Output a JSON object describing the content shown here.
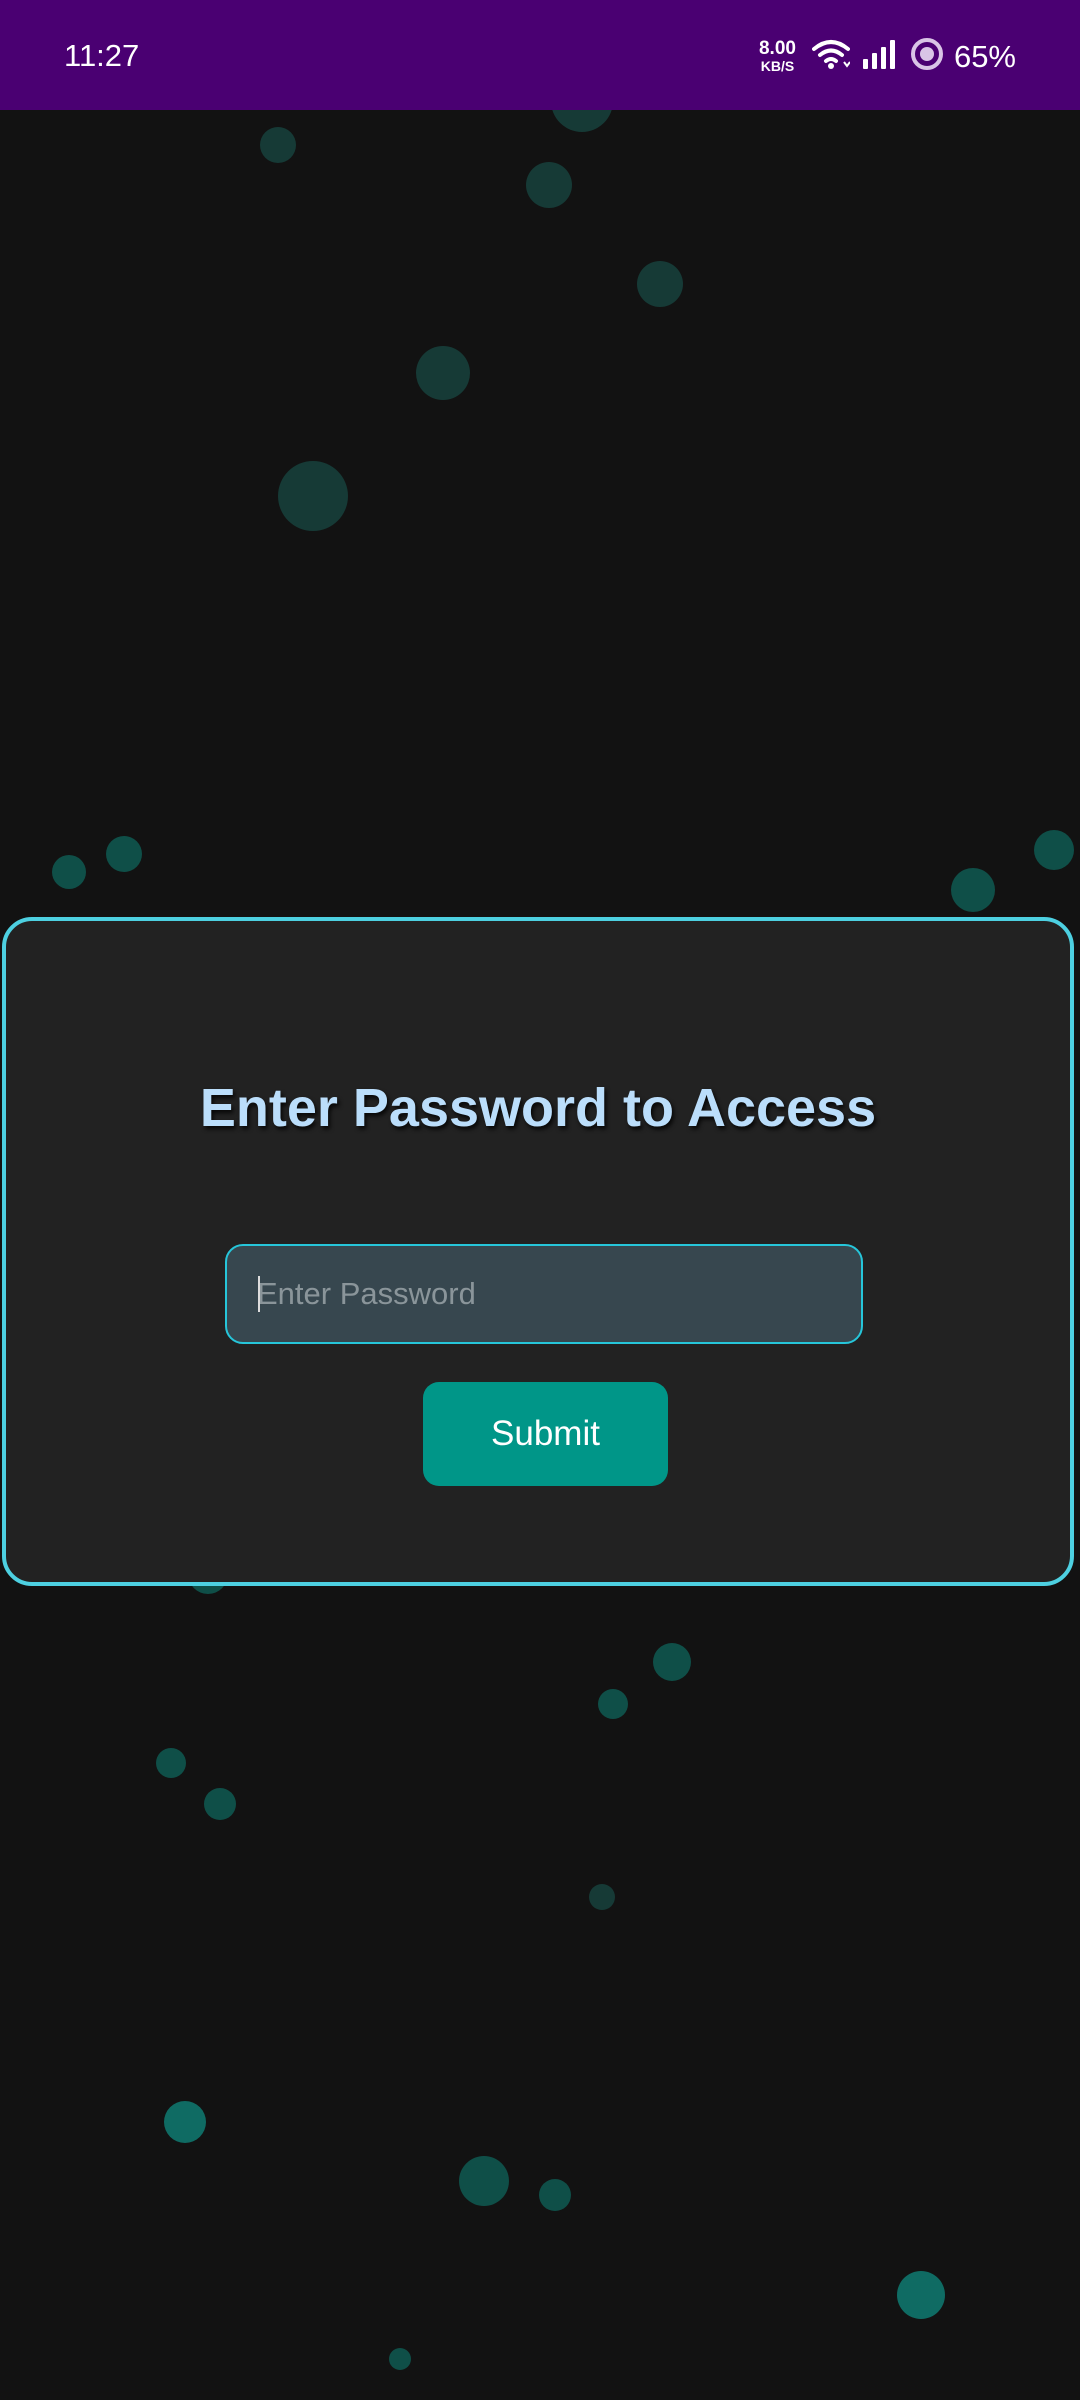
{
  "status_bar": {
    "time": "11:27",
    "net_speed_value": "8.00",
    "net_speed_unit": "KB/S",
    "wifi_icon": "wifi-icon",
    "signal_icon": "signal-bars-icon",
    "battery_icon": "battery-ring-icon",
    "battery_percent": "65%"
  },
  "card": {
    "title": "Enter Password to Access",
    "password_placeholder": "Enter Password",
    "submit_label": "Submit"
  },
  "colors": {
    "status_bar_bg": "#4a0072",
    "background": "#121212",
    "card_bg": "#222222",
    "card_border": "#4dd0e1",
    "title_color": "#bbdefb",
    "input_bg": "#37474f",
    "input_border": "#26c6da",
    "button_bg": "#009688",
    "dot_color": "#0f6b63"
  }
}
